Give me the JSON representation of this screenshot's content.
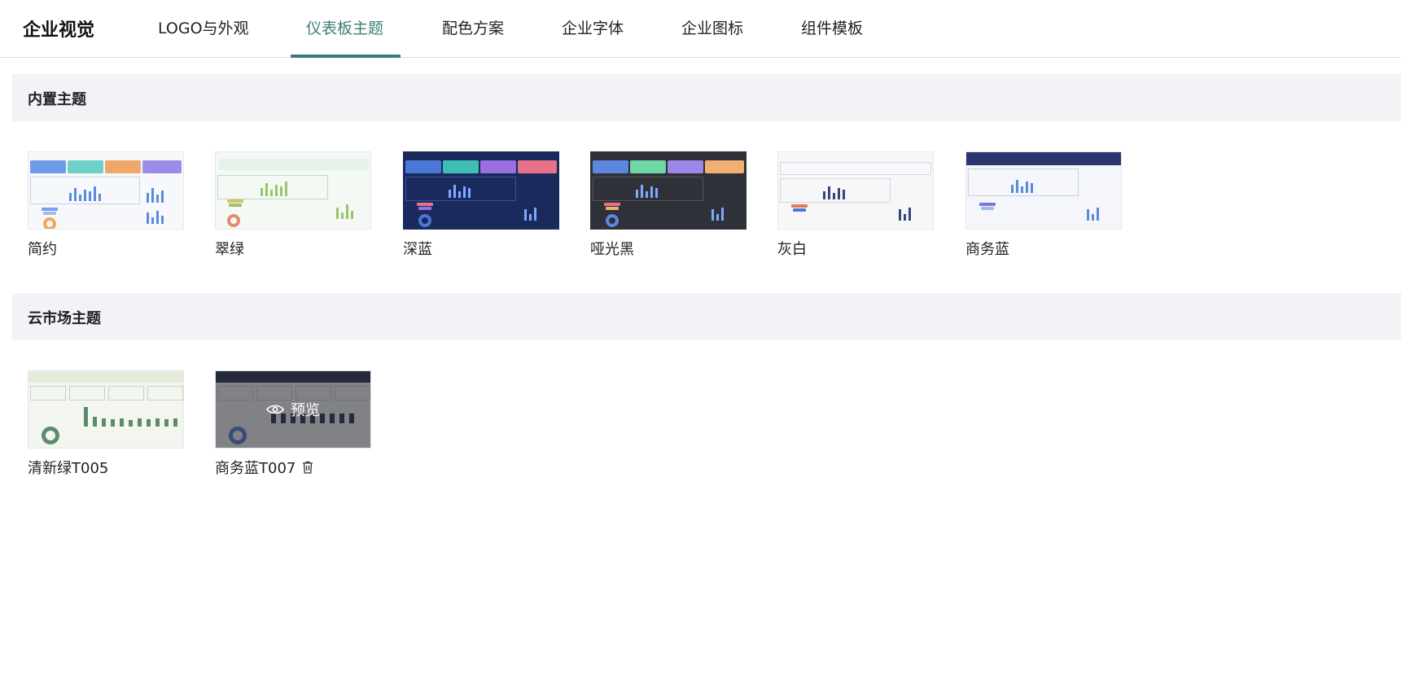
{
  "header": {
    "brand": "企业视觉",
    "tabs": [
      {
        "label": "LOGO与外观",
        "active": false
      },
      {
        "label": "仪表板主题",
        "active": true
      },
      {
        "label": "配色方案",
        "active": false
      },
      {
        "label": "企业字体",
        "active": false
      },
      {
        "label": "企业图标",
        "active": false
      },
      {
        "label": "组件模板",
        "active": false
      }
    ],
    "accent_color": "#3b7d76"
  },
  "sections": [
    {
      "title": "内置主题",
      "themes": [
        {
          "label": "简约"
        },
        {
          "label": "翠绿"
        },
        {
          "label": "深蓝"
        },
        {
          "label": "哑光黑"
        },
        {
          "label": "灰白"
        },
        {
          "label": "商务蓝"
        }
      ]
    },
    {
      "title": "云市场主题",
      "themes": [
        {
          "label": "清新绿T005"
        },
        {
          "label": "商务蓝T007",
          "hover_label": "预览",
          "icon": "trash-icon"
        }
      ]
    }
  ]
}
